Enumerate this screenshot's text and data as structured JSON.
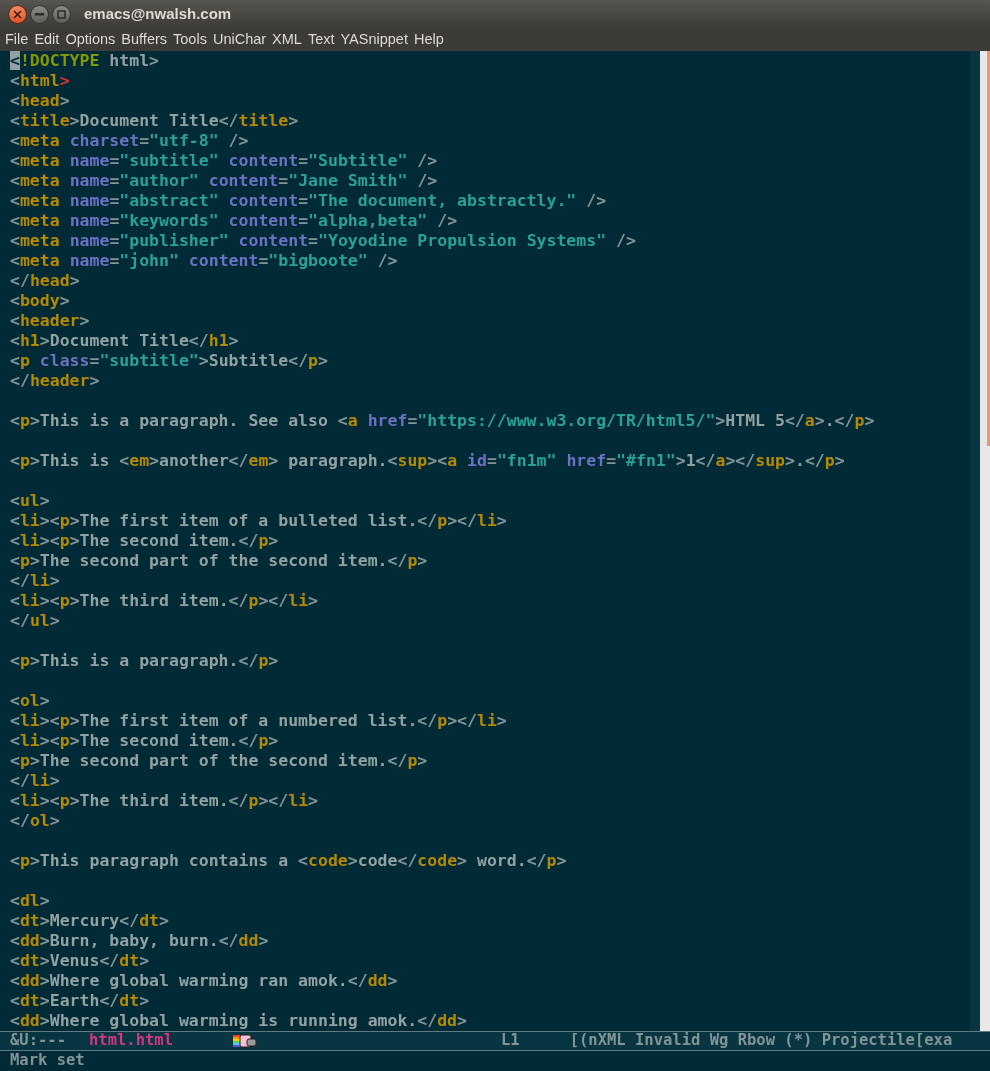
{
  "window": {
    "title": "emacs@nwalsh.com"
  },
  "menu": [
    "File",
    "Edit",
    "Options",
    "Buffers",
    "Tools",
    "UniChar",
    "XML",
    "Text",
    "YASnippet",
    "Help"
  ],
  "editor": {
    "lines": [
      {
        "kind": "code",
        "text": "<!DOCTYPE html>",
        "cursor": true,
        "matched": false
      },
      {
        "kind": "code",
        "text": "<html>",
        "cursor": false,
        "matched": true
      },
      {
        "kind": "code",
        "text": "<head>",
        "cursor": false,
        "matched": false
      },
      {
        "kind": "code",
        "text": "<title>Document Title</title>",
        "cursor": false,
        "matched": false
      },
      {
        "kind": "code",
        "text": "<meta charset=\"utf-8\" />",
        "cursor": false,
        "matched": false
      },
      {
        "kind": "code",
        "text": "<meta name=\"subtitle\" content=\"Subtitle\" />",
        "cursor": false,
        "matched": false
      },
      {
        "kind": "code",
        "text": "<meta name=\"author\" content=\"Jane Smith\" />",
        "cursor": false,
        "matched": false
      },
      {
        "kind": "code",
        "text": "<meta name=\"abstract\" content=\"The document, abstractly.\" />",
        "cursor": false,
        "matched": false
      },
      {
        "kind": "code",
        "text": "<meta name=\"keywords\" content=\"alpha,beta\" />",
        "cursor": false,
        "matched": false
      },
      {
        "kind": "code",
        "text": "<meta name=\"publisher\" content=\"Yoyodine Propulsion Systems\" />",
        "cursor": false,
        "matched": false
      },
      {
        "kind": "code",
        "text": "<meta name=\"john\" content=\"bigboote\" />",
        "cursor": false,
        "matched": false
      },
      {
        "kind": "code",
        "text": "</head>",
        "cursor": false,
        "matched": false
      },
      {
        "kind": "code",
        "text": "<body>",
        "cursor": false,
        "matched": false
      },
      {
        "kind": "code",
        "text": "<header>",
        "cursor": false,
        "matched": false
      },
      {
        "kind": "code",
        "text": "<h1>Document Title</h1>",
        "cursor": false,
        "matched": false
      },
      {
        "kind": "code",
        "text": "<p class=\"subtitle\">Subtitle</p>",
        "cursor": false,
        "matched": false
      },
      {
        "kind": "code",
        "text": "</header>",
        "cursor": false,
        "matched": false
      },
      {
        "kind": "blank"
      },
      {
        "kind": "code",
        "text": "<p>This is a paragraph. See also <a href=\"https://www.w3.org/TR/html5/\">HTML 5</a>.</p>",
        "cursor": false,
        "matched": false
      },
      {
        "kind": "blank"
      },
      {
        "kind": "code",
        "text": "<p>This is <em>another</em> paragraph.<sup><a id=\"fn1m\" href=\"#fn1\">1</a></sup>.</p>",
        "cursor": false,
        "matched": false
      },
      {
        "kind": "blank"
      },
      {
        "kind": "code",
        "text": "<ul>",
        "cursor": false,
        "matched": false
      },
      {
        "kind": "code",
        "text": "<li><p>The first item of a bulleted list.</p></li>",
        "cursor": false,
        "matched": false
      },
      {
        "kind": "code",
        "text": "<li><p>The second item.</p>",
        "cursor": false,
        "matched": false
      },
      {
        "kind": "code",
        "text": "<p>The second part of the second item.</p>",
        "cursor": false,
        "matched": false
      },
      {
        "kind": "code",
        "text": "</li>",
        "cursor": false,
        "matched": false
      },
      {
        "kind": "code",
        "text": "<li><p>The third item.</p></li>",
        "cursor": false,
        "matched": false
      },
      {
        "kind": "code",
        "text": "</ul>",
        "cursor": false,
        "matched": false
      },
      {
        "kind": "blank"
      },
      {
        "kind": "code",
        "text": "<p>This is a paragraph.</p>",
        "cursor": false,
        "matched": false
      },
      {
        "kind": "blank"
      },
      {
        "kind": "code",
        "text": "<ol>",
        "cursor": false,
        "matched": false
      },
      {
        "kind": "code",
        "text": "<li><p>The first item of a numbered list.</p></li>",
        "cursor": false,
        "matched": false
      },
      {
        "kind": "code",
        "text": "<li><p>The second item.</p>",
        "cursor": false,
        "matched": false
      },
      {
        "kind": "code",
        "text": "<p>The second part of the second item.</p>",
        "cursor": false,
        "matched": false
      },
      {
        "kind": "code",
        "text": "</li>",
        "cursor": false,
        "matched": false
      },
      {
        "kind": "code",
        "text": "<li><p>The third item.</p></li>",
        "cursor": false,
        "matched": false
      },
      {
        "kind": "code",
        "text": "</ol>",
        "cursor": false,
        "matched": false
      },
      {
        "kind": "blank"
      },
      {
        "kind": "code",
        "text": "<p>This paragraph contains a <code>code</code> word.</p>",
        "cursor": false,
        "matched": false
      },
      {
        "kind": "blank"
      },
      {
        "kind": "code",
        "text": "<dl>",
        "cursor": false,
        "matched": false
      },
      {
        "kind": "code",
        "text": "<dt>Mercury</dt>",
        "cursor": false,
        "matched": false
      },
      {
        "kind": "code",
        "text": "<dd>Burn, baby, burn.</dd>",
        "cursor": false,
        "matched": false
      },
      {
        "kind": "code",
        "text": "<dt>Venus</dt>",
        "cursor": false,
        "matched": false
      },
      {
        "kind": "code",
        "text": "<dd>Where global warming ran amok.</dd>",
        "cursor": false,
        "matched": false
      },
      {
        "kind": "code",
        "text": "<dt>Earth</dt>",
        "cursor": false,
        "matched": false
      },
      {
        "kind": "code",
        "text": "<dd>Where global warming is running amok.</dd>",
        "cursor": false,
        "matched": false
      }
    ]
  },
  "mode_line": {
    "status": "&U:---",
    "buffer": "html.html",
    "position": "L1",
    "modes": "[(nXML Invalid Wg Rbow (*) Projectile[exa"
  },
  "echo_area": "Mark set"
}
